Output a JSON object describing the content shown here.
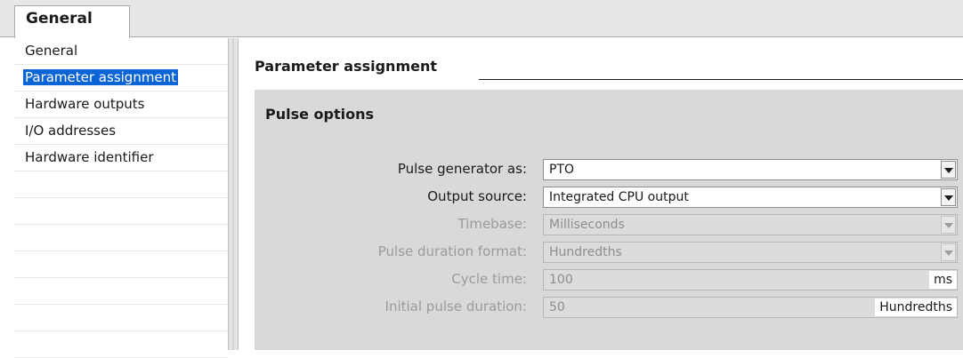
{
  "tab": {
    "label": "General"
  },
  "nav": {
    "items": [
      {
        "label": "General"
      },
      {
        "label": "Parameter assignment"
      },
      {
        "label": "Hardware outputs"
      },
      {
        "label": "I/O addresses"
      },
      {
        "label": "Hardware identifier"
      }
    ],
    "selected_index": 1
  },
  "section": {
    "title": "Parameter assignment"
  },
  "group": {
    "title": "Pulse options"
  },
  "fields": {
    "pulse_generator": {
      "label": "Pulse generator as:",
      "value": "PTO"
    },
    "output_source": {
      "label": "Output source:",
      "value": "Integrated CPU output"
    },
    "timebase": {
      "label": "Timebase:",
      "value": "Milliseconds"
    },
    "pulse_duration_format": {
      "label": "Pulse duration format:",
      "value": "Hundredths"
    },
    "cycle_time": {
      "label": "Cycle time:",
      "value": "100",
      "unit": "ms"
    },
    "initial_pulse_duration": {
      "label": "Initial pulse duration:",
      "value": "50",
      "unit": "Hundredths"
    }
  },
  "colors": {
    "selection": "#0a64d6",
    "group_background": "#d9d9d9",
    "disabled_text": "#9a9a9a"
  },
  "icons": {
    "dropdown": "chevron-down-icon"
  }
}
